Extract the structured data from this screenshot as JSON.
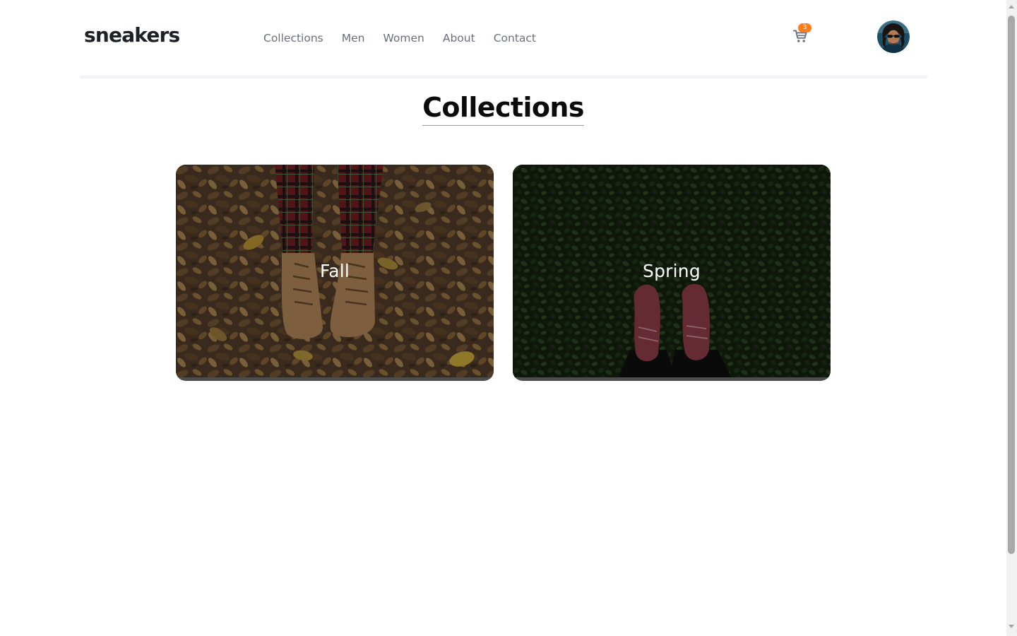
{
  "header": {
    "logo": "sneakers",
    "nav": [
      "Collections",
      "Men",
      "Women",
      "About",
      "Contact"
    ],
    "cart_count": "3",
    "cart_icon": "cart-icon",
    "avatar_icon": "user-avatar"
  },
  "main": {
    "title": "Collections",
    "collections": [
      {
        "label": "Fall"
      },
      {
        "label": "Spring"
      }
    ]
  },
  "colors": {
    "accent": "#ff7e1b",
    "title_underline": "#e08a1e",
    "text_dark": "#1d2025",
    "nav_text": "#69707d"
  }
}
